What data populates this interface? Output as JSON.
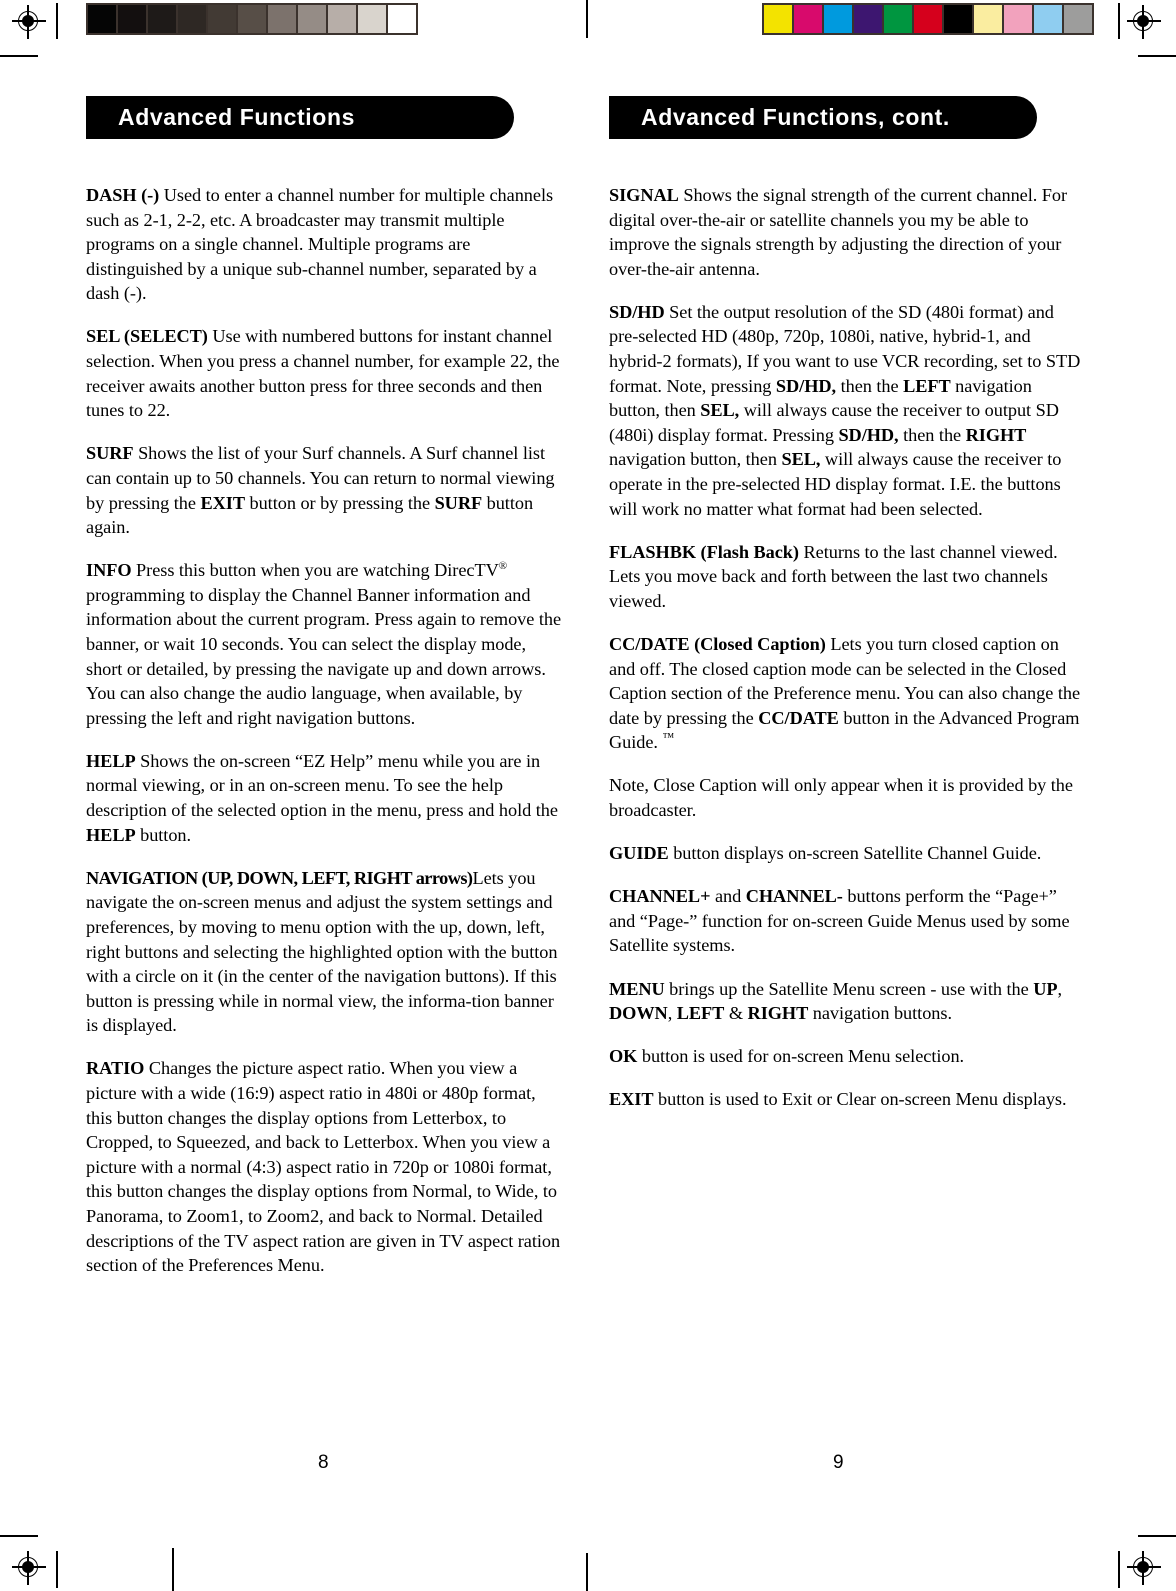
{
  "document": {
    "type": "printed-manual-spread",
    "gray_bar_swatches": [
      "#050505",
      "#130f0f",
      "#1e1a18",
      "#2e2824",
      "#423a34",
      "#574e47",
      "#7c726c",
      "#958c86",
      "#b7aea8",
      "#d9d4cd",
      "#ffffff"
    ],
    "color_bar_swatches": [
      "#f3e300",
      "#d80a6c",
      "#009ade",
      "#3d1670",
      "#009640",
      "#d5001c",
      "#000000",
      "#faeda0",
      "#f2a2bd",
      "#8fcdf0",
      "#9d9d9c"
    ]
  },
  "left_page": {
    "header": "Advanced Functions",
    "folio": "8",
    "paragraphs": [
      {
        "id": "dash",
        "runs": [
          {
            "t": "DASH (-)",
            "b": true
          },
          {
            "t": " Used to enter a channel number for multiple channels such as 2-1, 2-2, etc. A broadcaster may transmit multiple programs on a single channel. Multiple programs are distinguished by a unique sub-channel number, separated by a dash (-).",
            "b": false
          }
        ]
      },
      {
        "id": "sel",
        "runs": [
          {
            "t": "SEL (SELECT)",
            "b": true
          },
          {
            "t": " Use with numbered buttons for instant channel selection. When you press a channel number, for example 22, the receiver awaits another button press for three seconds and then tunes to 22.",
            "b": false
          }
        ]
      },
      {
        "id": "surf",
        "runs": [
          {
            "t": "SURF",
            "b": true
          },
          {
            "t": " Shows the list of your Surf channels. A Surf channel list can contain up to 50 channels. You can return to normal viewing by pressing the ",
            "b": false
          },
          {
            "t": "EXIT",
            "b": true
          },
          {
            "t": " button or by pressing the ",
            "b": false
          },
          {
            "t": "SURF",
            "b": true
          },
          {
            "t": " button again.",
            "b": false
          }
        ]
      },
      {
        "id": "info",
        "runs": [
          {
            "t": "INFO",
            "b": true
          },
          {
            "t": " Press this button when you are watching DirecTV",
            "b": false
          },
          {
            "t": "®",
            "b": false,
            "sup": "reg"
          },
          {
            "t": " programming to display the Channel Banner information and information about the current program. Press again to remove the banner, or wait 10 seconds. You can select the display mode, short or detailed,  by pressing the navigate up and down arrows. You can also change the audio language, when available, by pressing the left and right navigation buttons.",
            "b": false
          }
        ]
      },
      {
        "id": "help",
        "runs": [
          {
            "t": "HELP",
            "b": true
          },
          {
            "t": " Shows the on-screen “EZ Help” menu while you are in normal viewing, or in an on-screen menu. To see the help description of the selected option in the menu, press and hold the ",
            "b": false
          },
          {
            "t": "HELP",
            "b": true
          },
          {
            "t": " button.",
            "b": false
          }
        ]
      },
      {
        "id": "navigation",
        "runs": [
          {
            "t": "NAVIGATION (UP, DOWN, LEFT, RIGHT arrows)",
            "b": true,
            "tight": true
          },
          {
            "t": "Lets you navigate the on-screen menus and adjust the system settings and preferences, by moving to menu option with the up, down, left, right buttons and selecting the highlighted option with the button with a circle on it (in the center of the navigation buttons). If this button is pressing while in normal view, the informa-tion banner is displayed.",
            "b": false
          }
        ]
      },
      {
        "id": "ratio",
        "runs": [
          {
            "t": "RATIO",
            "b": true
          },
          {
            "t": " Changes the picture aspect ratio. When you view a picture with a wide (16:9) aspect ratio in 480i or 480p format, this button changes the display options from Letterbox, to Cropped, to Squeezed, and back to Letterbox. When you view a picture with a normal (4:3) aspect ratio in 720p or 1080i format, this button changes the display options from Normal, to Wide, to Panorama, to Zoom1, to Zoom2, and back to Normal. Detailed descriptions of the TV aspect ration are given in TV aspect ration section of the Preferences Menu.",
            "b": false
          }
        ]
      }
    ]
  },
  "right_page": {
    "header": "Advanced Functions, cont.",
    "folio": "9",
    "paragraphs": [
      {
        "id": "signal",
        "runs": [
          {
            "t": "SIGNAL",
            "b": true
          },
          {
            "t": " Shows the signal strength of the current channel. For digital over-the-air or satellite channels you my be able to improve the signals strength by adjusting the direction of your over-the-air antenna.",
            "b": false
          }
        ]
      },
      {
        "id": "sdhd",
        "runs": [
          {
            "t": "SD/HD",
            "b": true
          },
          {
            "t": " Set the output resolution of the SD (480i format) and pre-selected HD (480p, 720p, 1080i, native, hybrid-1, and hybrid-2 formats), If you want to use VCR recording, set to STD format. Note, pressing ",
            "b": false
          },
          {
            "t": "SD/HD,",
            "b": true
          },
          {
            "t": " then the ",
            "b": false
          },
          {
            "t": "LEFT",
            "b": true
          },
          {
            "t": " navigation button, then ",
            "b": false
          },
          {
            "t": "SEL,",
            "b": true
          },
          {
            "t": " will always cause the receiver to output SD (480i) display format.  Pressing ",
            "b": false
          },
          {
            "t": "SD/HD,",
            "b": true
          },
          {
            "t": " then the ",
            "b": false
          },
          {
            "t": "RIGHT",
            "b": true
          },
          {
            "t": " navigation button, then ",
            "b": false
          },
          {
            "t": "SEL,",
            "b": true
          },
          {
            "t": " will always cause the receiver to operate in the pre-selected HD display format. I.E. the buttons will work no matter what format had been selected.",
            "b": false
          }
        ]
      },
      {
        "id": "flashbk",
        "runs": [
          {
            "t": "FLASHBK (Flash Back)",
            "b": true
          },
          {
            "t": " Returns to the last channel viewed. Lets you move back and forth between the last two channels viewed.",
            "b": false
          }
        ]
      },
      {
        "id": "ccdate",
        "runs": [
          {
            "t": "CC/DATE (Closed Caption)",
            "b": true
          },
          {
            "t": " Lets you turn closed caption on and off. The closed caption mode can be selected in the Closed Caption section of the Preference menu. You can also change the date by pressing the ",
            "b": false
          },
          {
            "t": "CC/DATE",
            "b": true
          },
          {
            "t": " button in the Advanced Program Guide. ",
            "b": false
          },
          {
            "t": "™",
            "b": false,
            "sup": "tm"
          }
        ]
      },
      {
        "id": "cc-note",
        "runs": [
          {
            "t": "Note, Close Caption will only appear when it is provided by the broadcaster.",
            "b": false
          }
        ]
      },
      {
        "id": "guide",
        "runs": [
          {
            "t": "GUIDE",
            "b": true
          },
          {
            "t": " button displays on-screen Satellite Channel Guide.",
            "b": false
          }
        ]
      },
      {
        "id": "channel",
        "runs": [
          {
            "t": "CHANNEL+",
            "b": true
          },
          {
            "t": " and ",
            "b": false
          },
          {
            "t": "CHANNEL-",
            "b": true
          },
          {
            "t": " buttons perform the “Page+” and “Page-” function for on-screen Guide Menus used by some Satellite systems.",
            "b": false
          }
        ]
      },
      {
        "id": "menu",
        "runs": [
          {
            "t": "MENU",
            "b": true
          },
          {
            "t": " brings up the Satellite Menu screen - use with the ",
            "b": false
          },
          {
            "t": "UP",
            "b": true
          },
          {
            "t": ", ",
            "b": false
          },
          {
            "t": "DOWN",
            "b": true
          },
          {
            "t": ", ",
            "b": false
          },
          {
            "t": "LEFT",
            "b": true
          },
          {
            "t": " & ",
            "b": false
          },
          {
            "t": "RIGHT",
            "b": true
          },
          {
            "t": " navigation buttons.",
            "b": false
          }
        ]
      },
      {
        "id": "ok",
        "runs": [
          {
            "t": "OK",
            "b": true
          },
          {
            "t": " button is used for on-screen Menu selection.",
            "b": false
          }
        ]
      },
      {
        "id": "exit",
        "runs": [
          {
            "t": "EXIT",
            "b": true
          },
          {
            "t": " button is used to Exit or Clear on-screen Menu displays.",
            "b": false
          }
        ]
      }
    ]
  }
}
